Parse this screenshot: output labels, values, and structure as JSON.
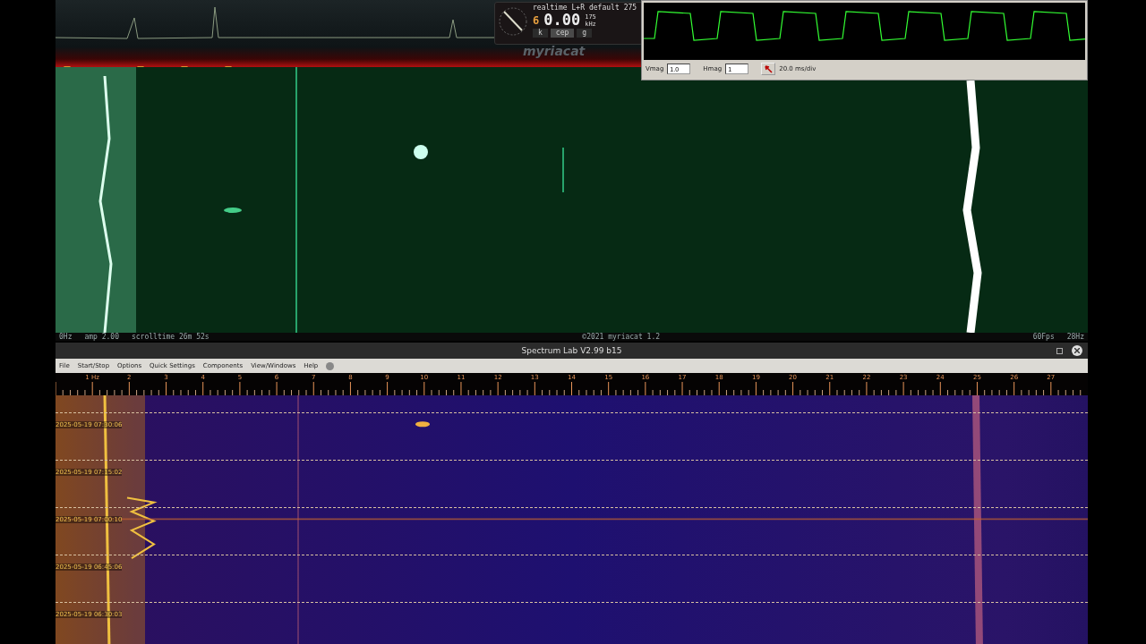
{
  "display": {
    "mode": "realtime",
    "channel": "L+R",
    "preset": "default",
    "top_value": "275",
    "digit": "6",
    "reading": "0.00",
    "range": "175",
    "unit": "kHz",
    "tabs": [
      {
        "label": "k",
        "selected": false
      },
      {
        "label": "cep",
        "selected": true
      },
      {
        "label": "g",
        "selected": false
      }
    ],
    "logo": "myriacat"
  },
  "scope": {
    "vmag_label": "Vmag",
    "vmag": "1.0",
    "hmag_label": "Hmag",
    "hmag": "1",
    "timebase": "20.0 ms/div"
  },
  "status_bar": {
    "left": "0Hz",
    "amp": "amp 2.00",
    "scrolltime": "scrolltime 26m 52s",
    "copyright": "©2021 myriacat 1.2",
    "fps": "60Fps",
    "right": "28Hz"
  },
  "spectrum_lab": {
    "title": "Spectrum Lab V2.99 b15",
    "menu": [
      "File",
      "Start/Stop",
      "Options",
      "Quick Settings",
      "Components",
      "View/Windows",
      "Help"
    ],
    "ruler": [
      "1 Hz",
      "2",
      "3",
      "4",
      "5",
      "6",
      "7",
      "8",
      "9",
      "10",
      "11",
      "12",
      "13",
      "14",
      "15",
      "16",
      "17",
      "18",
      "19",
      "20",
      "21",
      "22",
      "23",
      "24",
      "25",
      "26",
      "27"
    ],
    "timestamps": [
      "2025-05-19 07:30:06",
      "2025-05-19 07:15:02",
      "2025-05-19 07:00:10",
      "2025-05-19 06:45:06",
      "2025-05-19 06:30:03"
    ]
  }
}
